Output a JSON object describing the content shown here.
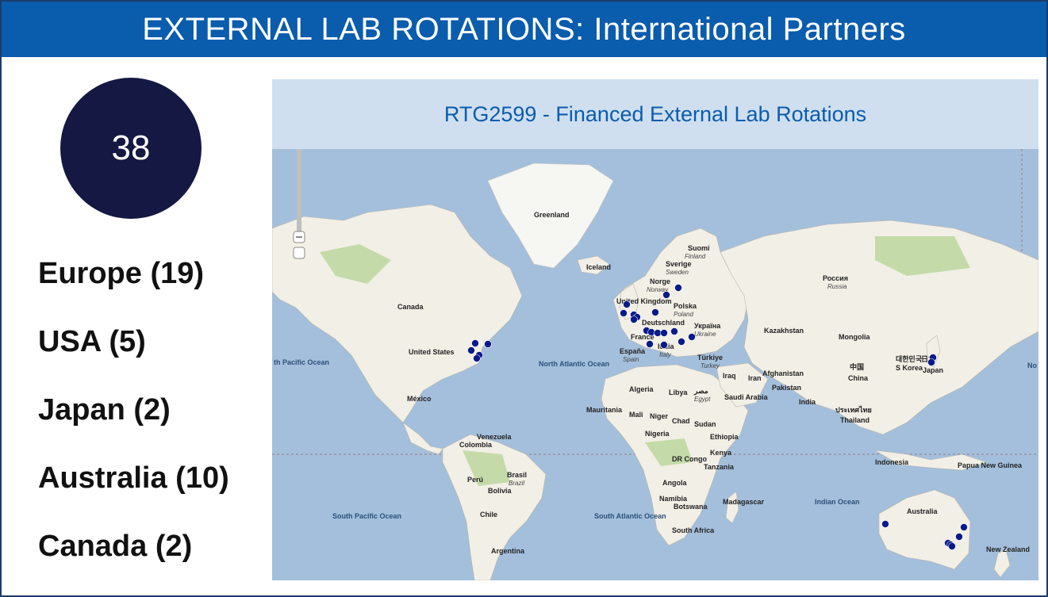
{
  "header": {
    "title": "EXTERNAL LAB ROTATIONS: International Partners"
  },
  "summary": {
    "total": "38"
  },
  "regions": [
    {
      "label": "Europe (19)"
    },
    {
      "label": "USA (5)"
    },
    {
      "label": "Japan (2)"
    },
    {
      "label": "Australia (10)"
    },
    {
      "label": "Canada (2)"
    }
  ],
  "map": {
    "title": "RTG2599 - Financed External Lab Rotations",
    "marker_color": "#0a1a8a",
    "places": {
      "greenland": "Greenland",
      "iceland": "Iceland",
      "canada": "Canada",
      "united_states": "United States",
      "mexico": "México",
      "suomi": "Suomi",
      "finland": "Finland",
      "sverige": "Sverige",
      "sweden": "Sweden",
      "norge": "Norge",
      "norway": "Norway",
      "united_kingdom": "United Kingdom",
      "polska": "Polska",
      "poland": "Poland",
      "deutschland": "Deutschland",
      "france": "France",
      "espana": "España",
      "spain": "Spain",
      "italia": "Italia",
      "italy": "Italy",
      "ukraina_ua": "Україна",
      "ukraine": "Ukraine",
      "turkiye": "Türkiye",
      "turkey": "Turkey",
      "rossiya": "Россия",
      "russia": "Russia",
      "kazakhstan": "Kazakhstan",
      "mongolia": "Mongolia",
      "china_zh": "中国",
      "china": "China",
      "korea_ko": "대한민국",
      "s_korea": "S Korea",
      "japan_ja": "日本",
      "japan": "Japan",
      "iraq": "Iraq",
      "iran": "Iran",
      "afghanistan": "Afghanistan",
      "pakistan": "Pakistan",
      "india": "India",
      "thailand_th": "ประเทศไทย",
      "thailand": "Thailand",
      "algeria": "Algeria",
      "libya": "Libya",
      "egypt_ar": "مصر",
      "egypt": "Egypt",
      "saudi_arabia": "Saudi Arabia",
      "mauritania": "Mauritania",
      "mali": "Mali",
      "niger": "Niger",
      "chad": "Chad",
      "sudan": "Sudan",
      "nigeria": "Nigeria",
      "ethiopia": "Ethiopia",
      "kenya": "Kenya",
      "dr_congo": "DR Congo",
      "tanzania": "Tanzania",
      "angola": "Angola",
      "namibia": "Namibia",
      "botswana": "Botswana",
      "south_africa": "South Africa",
      "madagascar": "Madagascar",
      "venezuela": "Venezuela",
      "colombia": "Colombia",
      "peru": "Perú",
      "bolivia": "Bolivia",
      "brasil": "Brasil",
      "brazil": "Brazil",
      "chile": "Chile",
      "argentina": "Argentina",
      "indonesia": "Indonesia",
      "papua": "Papua New Guinea",
      "australia": "Australia",
      "new_zealand": "New Zealand"
    },
    "oceans": {
      "north_pacific": "th Pacific Ocean",
      "north_atlantic": "North Atlantic Ocean",
      "south_pacific": "South Pacific Ocean",
      "south_atlantic": "South Atlantic Ocean",
      "indian": "Indian Ocean",
      "edge_right": "No"
    }
  }
}
